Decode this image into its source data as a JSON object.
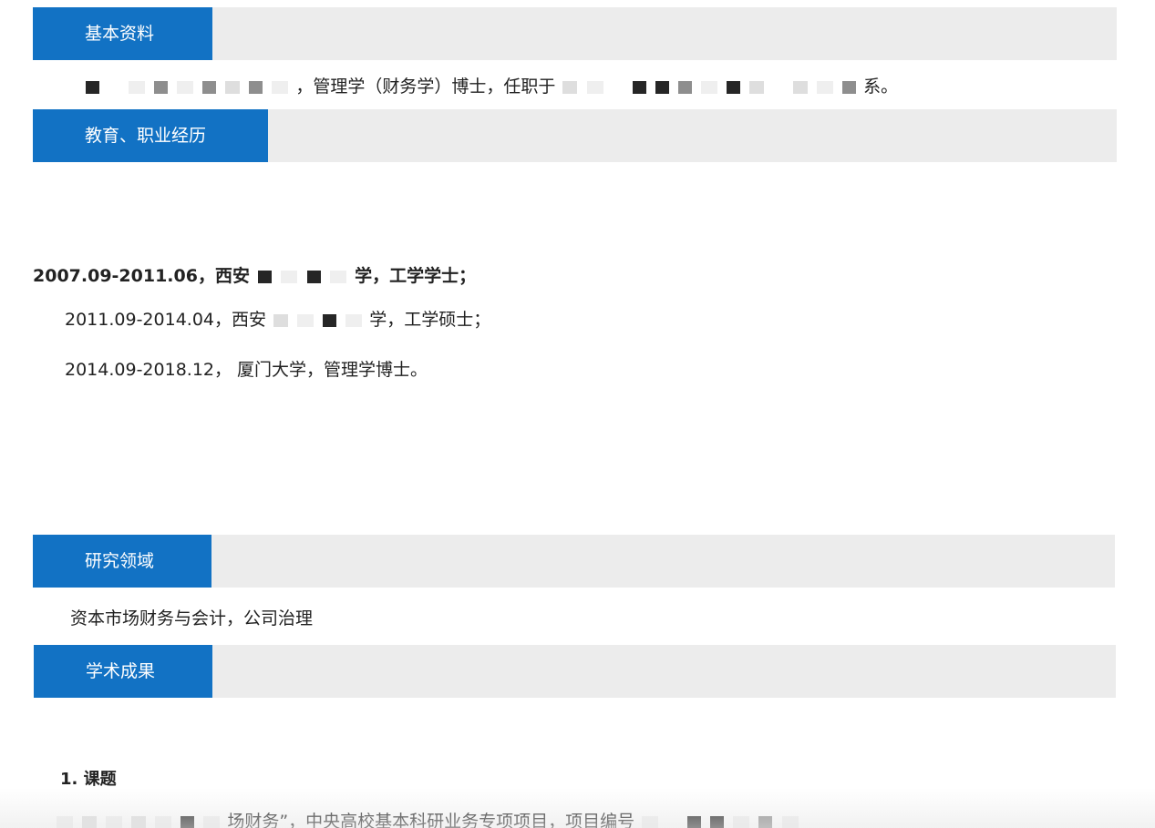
{
  "sections": {
    "basic": {
      "label": "基本资料"
    },
    "education": {
      "label": "教育、职业经历"
    },
    "research": {
      "label": "研究领域"
    },
    "achievements": {
      "label": "学术成果"
    }
  },
  "basic": {
    "intro_mid": "，管理学（财务学）博士，任职于",
    "intro_end": "系。"
  },
  "education": {
    "entry1_start": "2007.09-2011.06，西安",
    "entry1_end": "学，工学学士；",
    "entry2_start": "2011.09-2014.04，西安",
    "entry2_end": "学，工学硕士；",
    "entry3": "2014.09-2018.12， 厦门大学，管理学博士。"
  },
  "research": {
    "fields": "资本市场财务与会计，公司治理"
  },
  "achievements": {
    "topics_heading": "1. 课题",
    "topic1_mid": "场财务”，中央高校基本科研业务专项项目，项目编号"
  }
}
